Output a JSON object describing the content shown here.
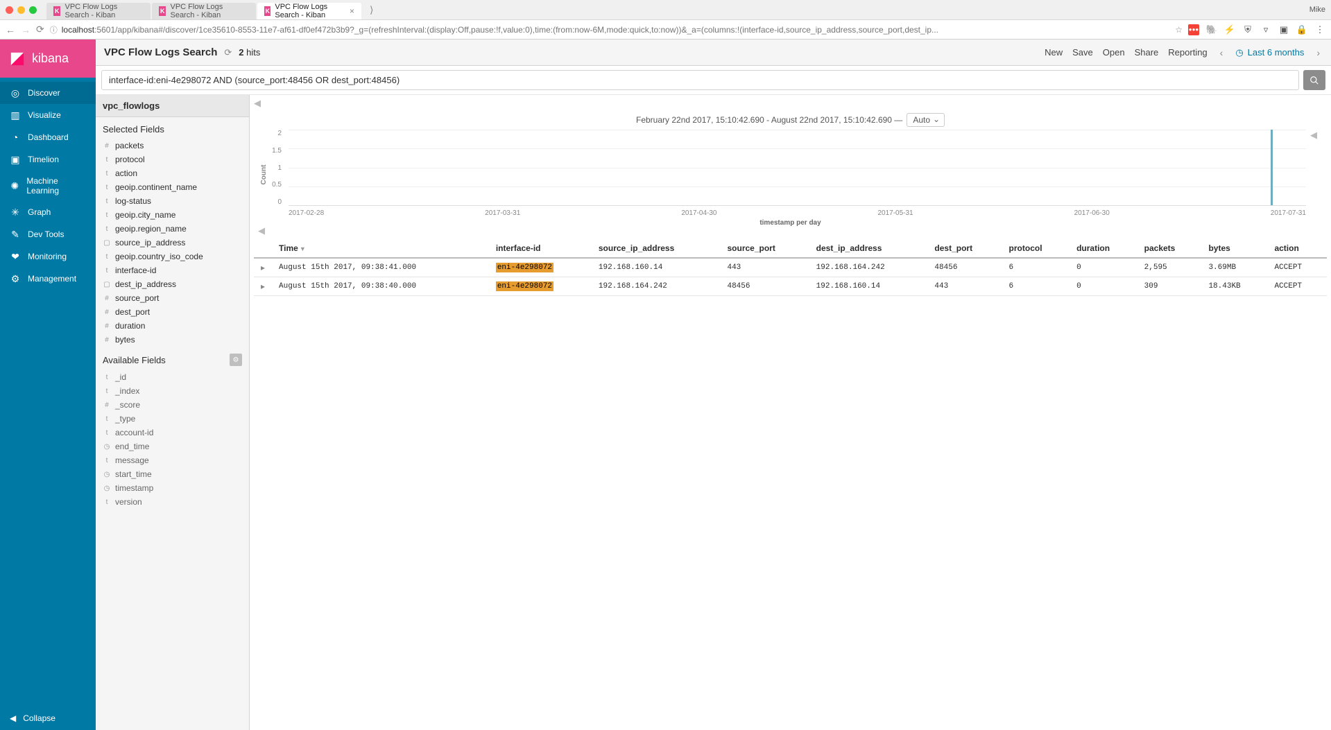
{
  "browser": {
    "tabs": [
      {
        "title": "VPC Flow Logs Search - Kiban",
        "active": false
      },
      {
        "title": "VPC Flow Logs Search - Kiban",
        "active": false
      },
      {
        "title": "VPC Flow Logs Search - Kiban",
        "active": true
      }
    ],
    "user": "Mike",
    "url_host": "localhost",
    "url_path": ":5601/app/kibana#/discover/1ce35610-8553-11e7-af61-df0ef472b3b9?_g=(refreshInterval:(display:Off,pause:!f,value:0),time:(from:now-6M,mode:quick,to:now))&_a=(columns:!(interface-id,source_ip_address,source_port,dest_ip..."
  },
  "kibana_nav": {
    "brand": "kibana",
    "items": [
      {
        "label": "Discover",
        "icon": "◎",
        "active": true
      },
      {
        "label": "Visualize",
        "icon": "▥",
        "active": false
      },
      {
        "label": "Dashboard",
        "icon": "◔",
        "active": false
      },
      {
        "label": "Timelion",
        "icon": "▣",
        "active": false
      },
      {
        "label": "Machine Learning",
        "icon": "✺",
        "active": false
      },
      {
        "label": "Graph",
        "icon": "✳",
        "active": false
      },
      {
        "label": "Dev Tools",
        "icon": "✎",
        "active": false
      },
      {
        "label": "Monitoring",
        "icon": "❤",
        "active": false
      },
      {
        "label": "Management",
        "icon": "⚙",
        "active": false
      }
    ],
    "collapse_label": "Collapse"
  },
  "topbar": {
    "title": "VPC Flow Logs Search",
    "hits_count": "2",
    "hits_label": "hits",
    "actions": [
      "New",
      "Save",
      "Open",
      "Share",
      "Reporting"
    ],
    "time_label": "Last 6 months"
  },
  "query": "interface-id:eni-4e298072 AND (source_port:48456 OR dest_port:48456)",
  "fields_sidebar": {
    "index_pattern": "vpc_flowlogs",
    "selected_title": "Selected Fields",
    "selected": [
      {
        "type": "#",
        "name": "packets"
      },
      {
        "type": "t",
        "name": "protocol"
      },
      {
        "type": "t",
        "name": "action"
      },
      {
        "type": "t",
        "name": "geoip.continent_name"
      },
      {
        "type": "t",
        "name": "log-status"
      },
      {
        "type": "t",
        "name": "geoip.city_name"
      },
      {
        "type": "t",
        "name": "geoip.region_name"
      },
      {
        "type": "▢",
        "name": "source_ip_address"
      },
      {
        "type": "t",
        "name": "geoip.country_iso_code"
      },
      {
        "type": "t",
        "name": "interface-id"
      },
      {
        "type": "▢",
        "name": "dest_ip_address"
      },
      {
        "type": "#",
        "name": "source_port"
      },
      {
        "type": "#",
        "name": "dest_port"
      },
      {
        "type": "#",
        "name": "duration"
      },
      {
        "type": "#",
        "name": "bytes"
      }
    ],
    "available_title": "Available Fields",
    "available": [
      {
        "type": "t",
        "name": "_id"
      },
      {
        "type": "t",
        "name": "_index"
      },
      {
        "type": "#",
        "name": "_score"
      },
      {
        "type": "t",
        "name": "_type"
      },
      {
        "type": "t",
        "name": "account-id"
      },
      {
        "type": "◷",
        "name": "end_time"
      },
      {
        "type": "t",
        "name": "message"
      },
      {
        "type": "◷",
        "name": "start_time"
      },
      {
        "type": "◷",
        "name": "timestamp"
      },
      {
        "type": "t",
        "name": "version"
      }
    ]
  },
  "histogram": {
    "range_label": "February 22nd 2017, 15:10:42.690 - August 22nd 2017, 15:10:42.690 —",
    "interval": "Auto",
    "y_label": "Count",
    "x_label": "timestamp per day",
    "y_ticks": [
      "2",
      "1.5",
      "1",
      "0.5",
      "0"
    ],
    "x_ticks": [
      "2017-02-28",
      "2017-03-31",
      "2017-04-30",
      "2017-05-31",
      "2017-06-30",
      "2017-07-31"
    ]
  },
  "chart_data": {
    "type": "bar",
    "title": "",
    "xlabel": "timestamp per day",
    "ylabel": "Count",
    "ylim": [
      0,
      2
    ],
    "categories": [
      "2017-08-15"
    ],
    "values": [
      2
    ]
  },
  "doc_table": {
    "columns": [
      "Time",
      "interface-id",
      "source_ip_address",
      "source_port",
      "dest_ip_address",
      "dest_port",
      "protocol",
      "duration",
      "packets",
      "bytes",
      "action"
    ],
    "sort_col": "Time",
    "rows": [
      {
        "time": "August 15th 2017, 09:38:41.000",
        "interface_id": "eni-4e298072",
        "source_ip": "192.168.160.14",
        "source_port": "443",
        "dest_ip": "192.168.164.242",
        "dest_port": "48456",
        "protocol": "6",
        "duration": "0",
        "packets": "2,595",
        "bytes": "3.69MB",
        "action": "ACCEPT"
      },
      {
        "time": "August 15th 2017, 09:38:40.000",
        "interface_id": "eni-4e298072",
        "source_ip": "192.168.164.242",
        "source_port": "48456",
        "dest_ip": "192.168.160.14",
        "dest_port": "443",
        "protocol": "6",
        "duration": "0",
        "packets": "309",
        "bytes": "18.43KB",
        "action": "ACCEPT"
      }
    ]
  }
}
